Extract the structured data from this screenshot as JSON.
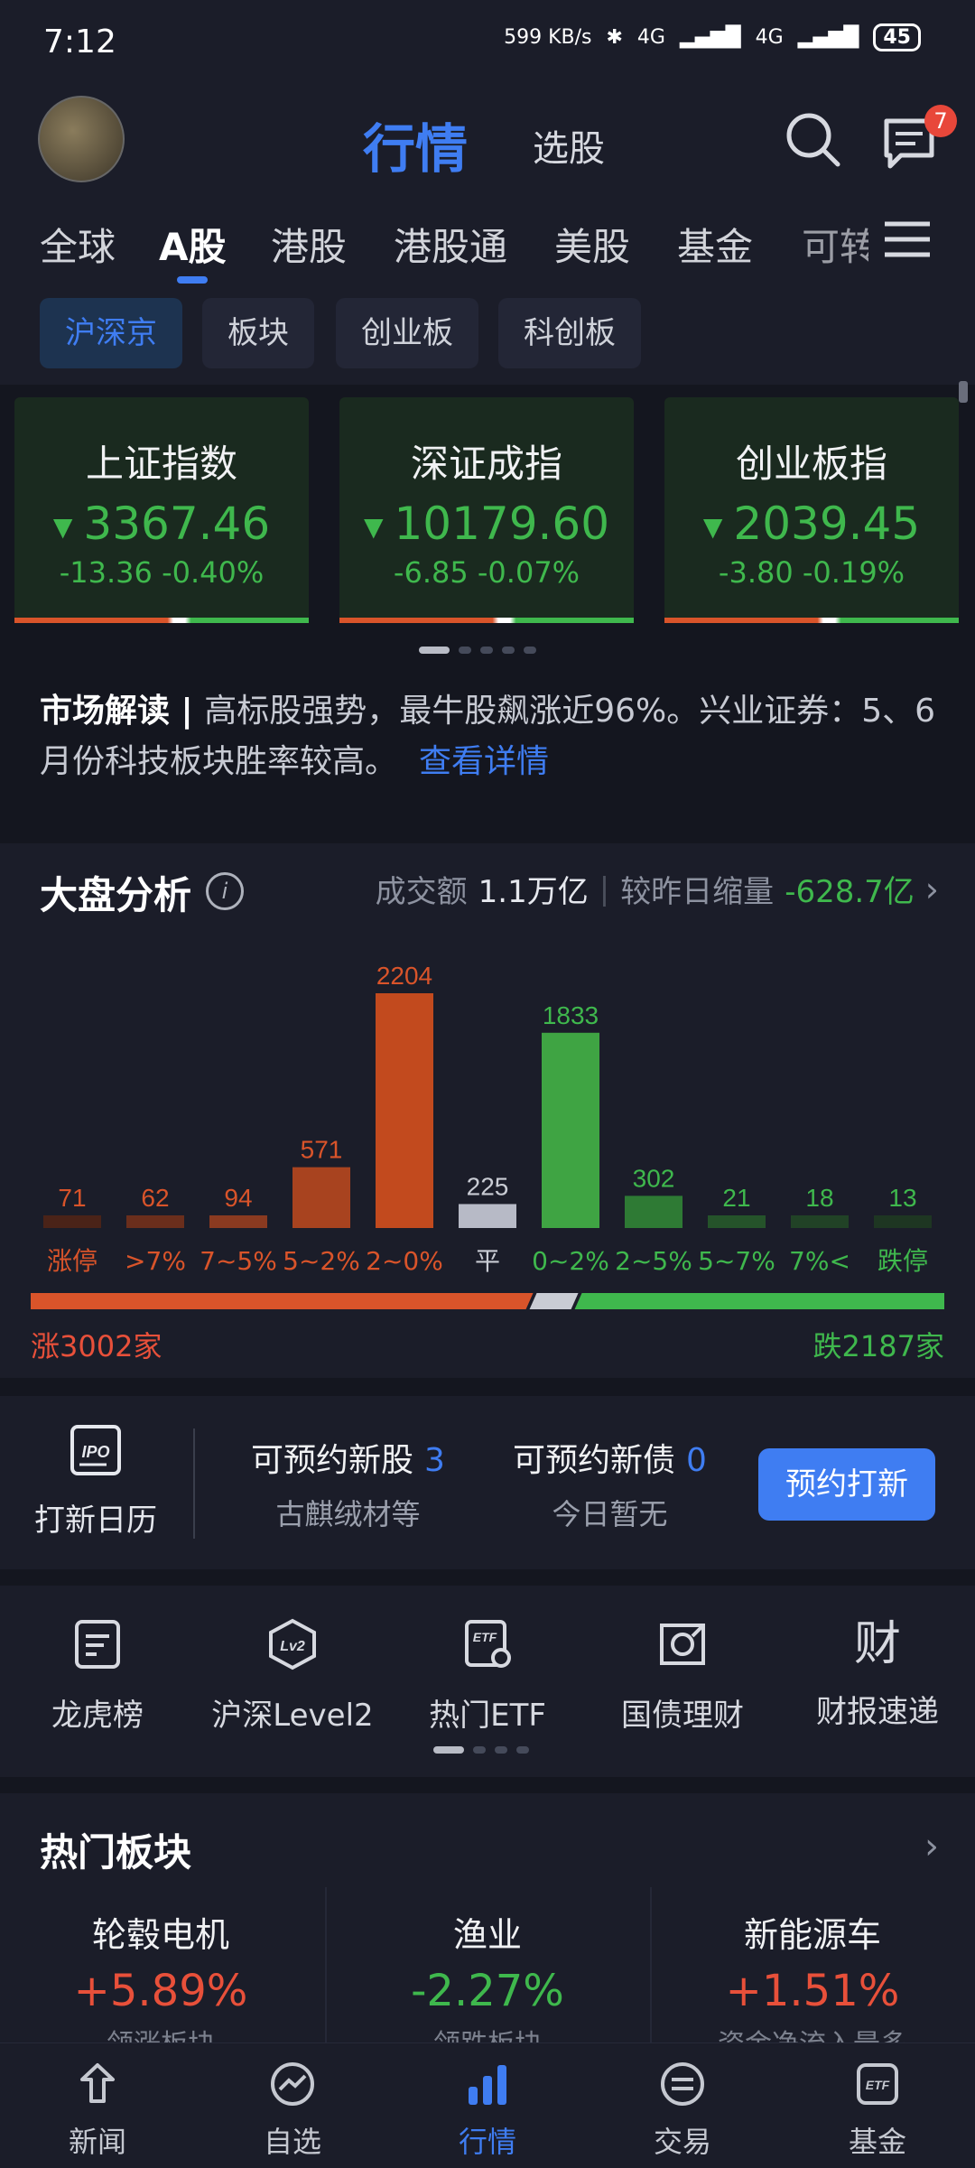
{
  "status_bar": {
    "time": "7:12",
    "speed": "599 KB/s",
    "network_1": "4G",
    "network_2": "4G",
    "battery": "45"
  },
  "header": {
    "title_active": "行情",
    "title_inactive": "选股",
    "message_badge": "7"
  },
  "market_tabs": [
    "全球",
    "A股",
    "港股",
    "港股通",
    "美股",
    "基金",
    "可转"
  ],
  "sub_chips": [
    "沪深京",
    "板块",
    "创业板",
    "科创板"
  ],
  "indices": [
    {
      "name": "上证指数",
      "value": "3367.46",
      "change": "-13.36",
      "pct": "-0.40%"
    },
    {
      "name": "深证成指",
      "value": "10179.60",
      "change": "-6.85",
      "pct": "-0.07%"
    },
    {
      "name": "创业板指",
      "value": "2039.45",
      "change": "-3.80",
      "pct": "-0.19%"
    }
  ],
  "news": {
    "label": "市场解读",
    "text": "高标股强势，最牛股飙涨近96%。兴业证券：5、6月份科技板块胜率较高。",
    "link": "查看详情"
  },
  "analysis": {
    "title": "大盘分析",
    "turnover_label": "成交额",
    "turnover_value": "1.1万亿",
    "compare_label": "较昨日缩量",
    "compare_value": "-628.7亿",
    "up_total": "涨3002家",
    "down_total": "跌2187家",
    "up_count": 3002,
    "flat_count": 225,
    "down_count": 2187
  },
  "chart_data": {
    "type": "bar",
    "title": "大盘分析",
    "categories": [
      "涨停",
      ">7%",
      "7~5%",
      "5~2%",
      "2~0%",
      "平",
      "0~2%",
      "2~5%",
      "5~7%",
      "7%<",
      "跌停"
    ],
    "values": [
      71,
      62,
      94,
      571,
      2204,
      225,
      1833,
      302,
      21,
      18,
      13
    ],
    "colors": [
      "#4a2318",
      "#6a2e1c",
      "#8a3a20",
      "#a8431f",
      "#c24a1e",
      "#b7bac6",
      "#3fa443",
      "#2e7a34",
      "#25532a",
      "#214226",
      "#1e3622"
    ],
    "label_colors": [
      "#d9542a",
      "#d9542a",
      "#d9542a",
      "#d9542a",
      "#d9542a",
      "#c9ccd4",
      "#3fb84d",
      "#3fb84d",
      "#3fb84d",
      "#3fb84d",
      "#3fb84d"
    ],
    "xlabel": "",
    "ylabel": ""
  },
  "ipo": {
    "calendar_label": "打新日历",
    "new_stock_label": "可预约新股",
    "new_stock_count": "3",
    "new_stock_sub": "古麒绒材等",
    "new_bond_label": "可预约新债",
    "new_bond_count": "0",
    "new_bond_sub": "今日暂无",
    "button": "预约打新"
  },
  "quick_entries": [
    {
      "label": "龙虎榜",
      "icon": "list-doc-icon"
    },
    {
      "label": "沪深Level2",
      "icon": "lv2-icon"
    },
    {
      "label": "热门ETF",
      "icon": "etf-icon"
    },
    {
      "label": "国债理财",
      "icon": "bond-icon"
    },
    {
      "label": "财报速递",
      "icon": "cai-icon"
    }
  ],
  "hot_sectors": {
    "title": "热门板块",
    "items": [
      {
        "name": "轮毂电机",
        "pct": "+5.89%",
        "sub": "领涨板块",
        "color": "#e8503a"
      },
      {
        "name": "渔业",
        "pct": "-2.27%",
        "sub": "领跌板块",
        "color": "#3fb84d"
      },
      {
        "name": "新能源车",
        "pct": "+1.51%",
        "sub": "资金净流入最多",
        "color": "#e8503a"
      }
    ]
  },
  "tab_bar": [
    {
      "label": "新闻",
      "icon": "news-icon"
    },
    {
      "label": "自选",
      "icon": "watchlist-icon"
    },
    {
      "label": "行情",
      "icon": "market-icon",
      "active": true
    },
    {
      "label": "交易",
      "icon": "trade-icon"
    },
    {
      "label": "基金",
      "icon": "fund-etf-icon"
    }
  ]
}
